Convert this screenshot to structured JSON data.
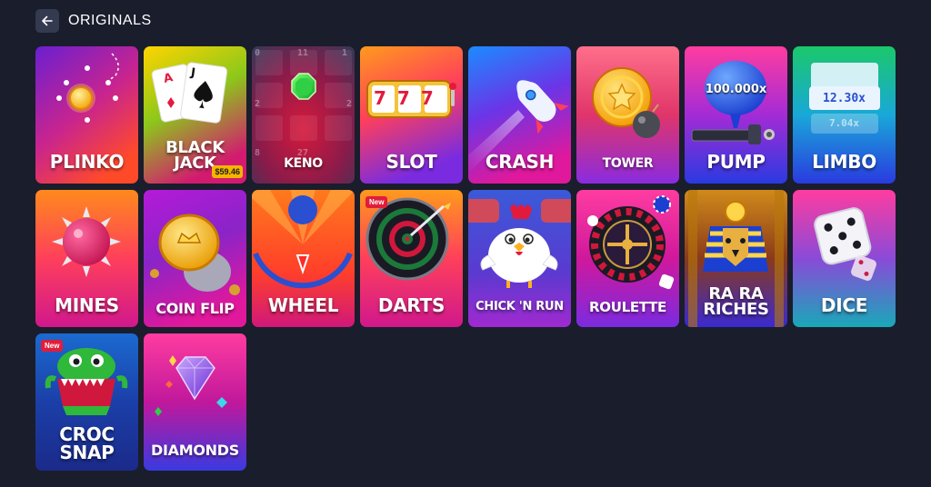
{
  "header": {
    "back_icon": "arrow-left-icon",
    "title": "ORIGINALS"
  },
  "colors": {
    "background": "#1a1d2b",
    "back_button": "#343a4f",
    "new_badge": "#e11d3a",
    "price_badge": "#f5b400"
  },
  "games": {
    "plinko": {
      "label": "PLINKO"
    },
    "blackjack": {
      "label": "BLACK\nJACK",
      "price": "$59.46",
      "card_1": "A",
      "card_2": "J"
    },
    "keno": {
      "label": "KENO",
      "n1": "0",
      "n2": "11",
      "n3": "1",
      "n4": "2",
      "n5": "2",
      "n6": "8",
      "n7": "27"
    },
    "slot": {
      "label": "SLOT",
      "reels": "777"
    },
    "crash": {
      "label": "CRASH"
    },
    "tower": {
      "label": "TOWER"
    },
    "pump": {
      "label": "PUMP",
      "multiplier": "100.000x"
    },
    "limbo": {
      "label": "LIMBO",
      "multiplier": "12.30x",
      "multiplier_shadow": "7.04x"
    },
    "mines": {
      "label": "MINES"
    },
    "coin_flip": {
      "label": "COIN FLIP"
    },
    "wheel": {
      "label": "WHEEL"
    },
    "darts": {
      "label": "DARTS",
      "badge": "New"
    },
    "chick_n_run": {
      "label": "CHICK 'N RUN"
    },
    "roulette": {
      "label": "ROULETTE"
    },
    "ra_ra_riches": {
      "label": "RA RA\nRICHES"
    },
    "dice": {
      "label": "DICE"
    },
    "croc_snap": {
      "label": "CROC\nSNAP",
      "badge": "New"
    },
    "diamonds": {
      "label": "DIAMONDS"
    }
  }
}
